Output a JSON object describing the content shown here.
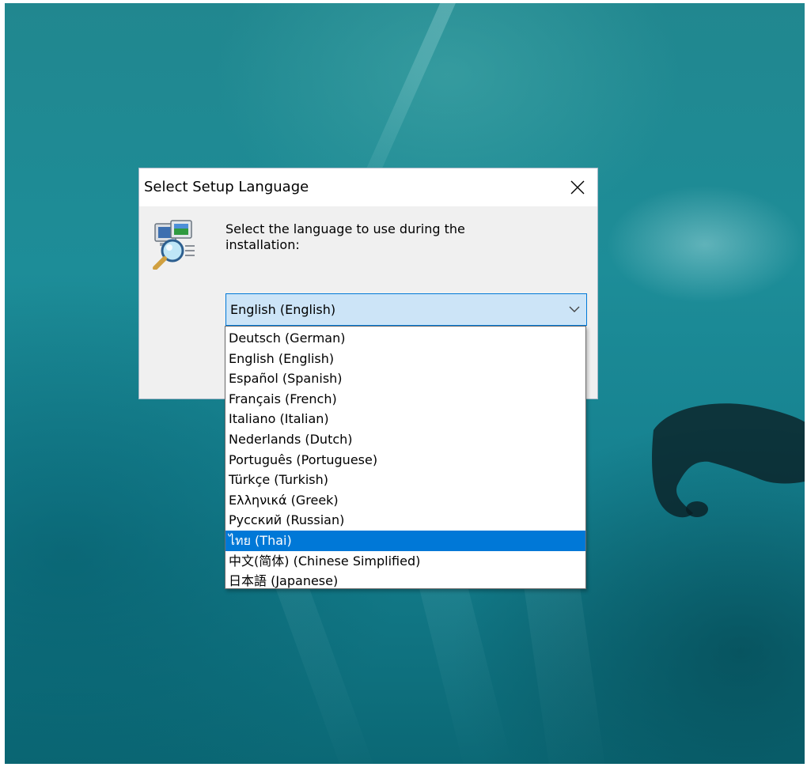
{
  "dialog": {
    "title": "Select Setup Language",
    "prompt": "Select the language to use during the installation:",
    "icons": {
      "app": "setup-computer-magnifier-icon",
      "close": "close-icon",
      "dropdown": "chevron-down-icon"
    }
  },
  "language_select": {
    "selected_value": "English (English)",
    "highlighted_index": 10,
    "options": [
      "Deutsch (German)",
      "English (English)",
      "Español (Spanish)",
      "Français (French)",
      "Italiano (Italian)",
      "Nederlands (Dutch)",
      "Português (Portuguese)",
      "Türkçe (Turkish)",
      "Ελληνικά (Greek)",
      "Русский (Russian)",
      "ไทย (Thai)",
      "中文(简体) (Chinese Simplified)",
      "日本語 (Japanese)"
    ]
  },
  "colors": {
    "accent": "#0078d7",
    "combo_background": "#cce4f7",
    "dialog_background": "#f0f0f0",
    "desktop": "#1d8d98"
  }
}
